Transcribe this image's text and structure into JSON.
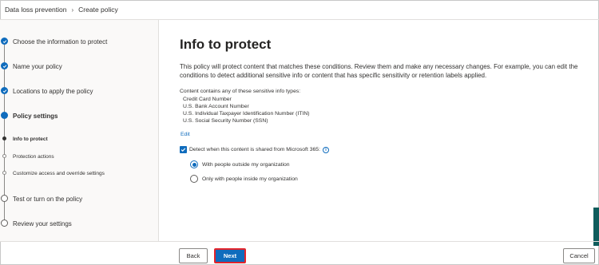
{
  "breadcrumb": {
    "items": [
      "Data loss prevention",
      "Create policy"
    ]
  },
  "wizard": {
    "steps": [
      {
        "label": "Choose the information to protect",
        "state": "done"
      },
      {
        "label": "Name your policy",
        "state": "done"
      },
      {
        "label": "Locations to apply the policy",
        "state": "done"
      },
      {
        "label": "Policy settings",
        "state": "current"
      },
      {
        "label": "Info to protect",
        "state": "current-sub"
      },
      {
        "label": "Protection actions",
        "state": "pending-sub"
      },
      {
        "label": "Customize access and override settings",
        "state": "pending-sub"
      },
      {
        "label": "Test or turn on the policy",
        "state": "pending"
      },
      {
        "label": "Review your settings",
        "state": "pending"
      }
    ]
  },
  "main": {
    "title": "Info to protect",
    "description": "This policy will protect content that matches these conditions. Review them and make any necessary changes. For example, you can edit the conditions to detect additional sensitive info or content that has specific sensitivity or retention labels applied.",
    "conditions_heading": "Content contains any of these sensitive info types:",
    "info_types": [
      "Credit Card Number",
      "U.S. Bank Account Number",
      "U.S. Individual Taxpayer Identification Number (ITIN)",
      "U.S. Social Security Number (SSN)"
    ],
    "edit_label": "Edit",
    "detect_checkbox": {
      "label": "Detect when this content is shared from Microsoft 365:",
      "checked": true
    },
    "radio_options": [
      {
        "label": "With people outside my organization",
        "selected": true
      },
      {
        "label": "Only with people inside my organization",
        "selected": false
      }
    ]
  },
  "footer": {
    "back_label": "Back",
    "next_label": "Next",
    "cancel_label": "Cancel"
  },
  "colors": {
    "accent": "#0f6cbd",
    "highlight_border": "#e3242b"
  }
}
